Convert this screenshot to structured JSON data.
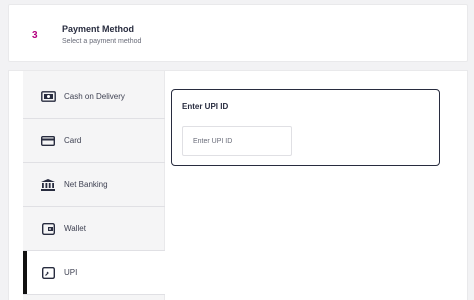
{
  "step": {
    "number": "3",
    "title": "Payment Method",
    "subtitle": "Select a payment method"
  },
  "methods": [
    {
      "label": "Cash on Delivery",
      "icon": "cash-icon",
      "active": false
    },
    {
      "label": "Card",
      "icon": "card-icon",
      "active": false
    },
    {
      "label": "Net Banking",
      "icon": "bank-icon",
      "active": false
    },
    {
      "label": "Wallet",
      "icon": "wallet-icon",
      "active": false
    },
    {
      "label": "UPI",
      "icon": "upi-icon",
      "active": true
    }
  ],
  "upi": {
    "title": "Enter UPI ID",
    "placeholder": "Enter UPI ID",
    "value": ""
  },
  "colors": {
    "accent": "#b4007f",
    "text": "#282c3f",
    "active_bar": "#111111"
  }
}
